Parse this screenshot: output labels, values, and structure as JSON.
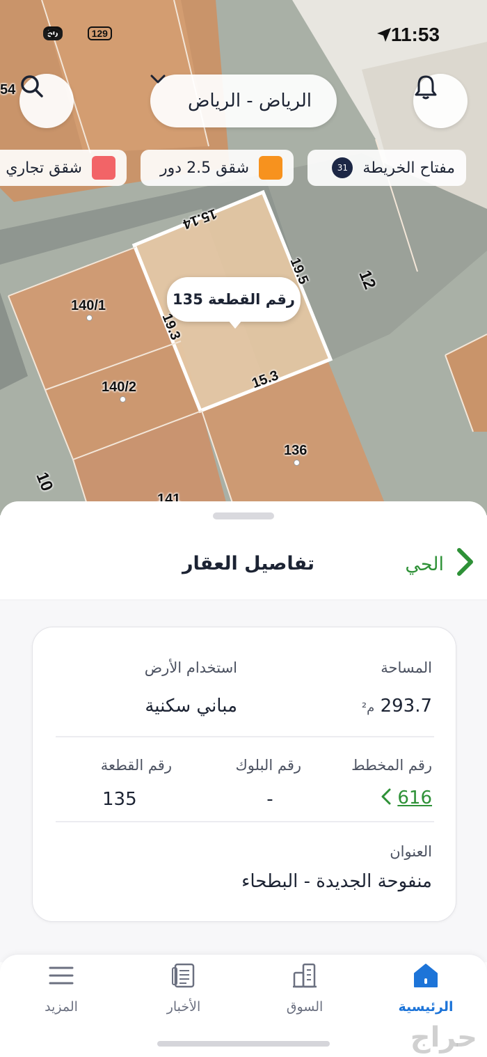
{
  "status": {
    "time": "11:53",
    "left_badge": "50",
    "battery": "129"
  },
  "header": {
    "city_selector": "الرياض - الرياض"
  },
  "legend_chips": {
    "map_key": "مفتاح الخريطة",
    "map_key_badge": "31",
    "apartments": "شقق 2.5 دور",
    "apartments_color": "#f7921e",
    "commercial": "شقق تجاري",
    "commercial_color": "#f26467"
  },
  "map": {
    "callout": "رقم القطعة 135",
    "edge_top": "15.14",
    "edge_right": "19.5",
    "edge_left": "19.3",
    "edge_bottom": "15.3",
    "street_12": "12",
    "street_10": "10",
    "plot_1401": "140/1",
    "plot_1402": "140/2",
    "plot_136": "136",
    "plot_141": "141",
    "corner_label": "54"
  },
  "sheet": {
    "title": "تفاصيل العقار",
    "district_link": "الحي",
    "area_label": "المساحة",
    "area_value": "293.7",
    "area_unit": "م²",
    "land_use_label": "استخدام الأرض",
    "land_use_value": "مباني سكنية",
    "plan_label": "رقم المخطط",
    "plan_value": "616",
    "block_label": "رقم البلوك",
    "block_value": "-",
    "plot_label": "رقم القطعة",
    "plot_value": "135",
    "address_label": "العنوان",
    "address_value": "منفوحة الجديدة - البطحاء"
  },
  "tabs": {
    "home": "الرئيسية",
    "market": "السوق",
    "news": "الأخبار",
    "more": "المزيد"
  },
  "colors": {
    "accent_green": "#2e9137",
    "active_blue": "#1d74d8",
    "dark_navy": "#1c2333"
  }
}
